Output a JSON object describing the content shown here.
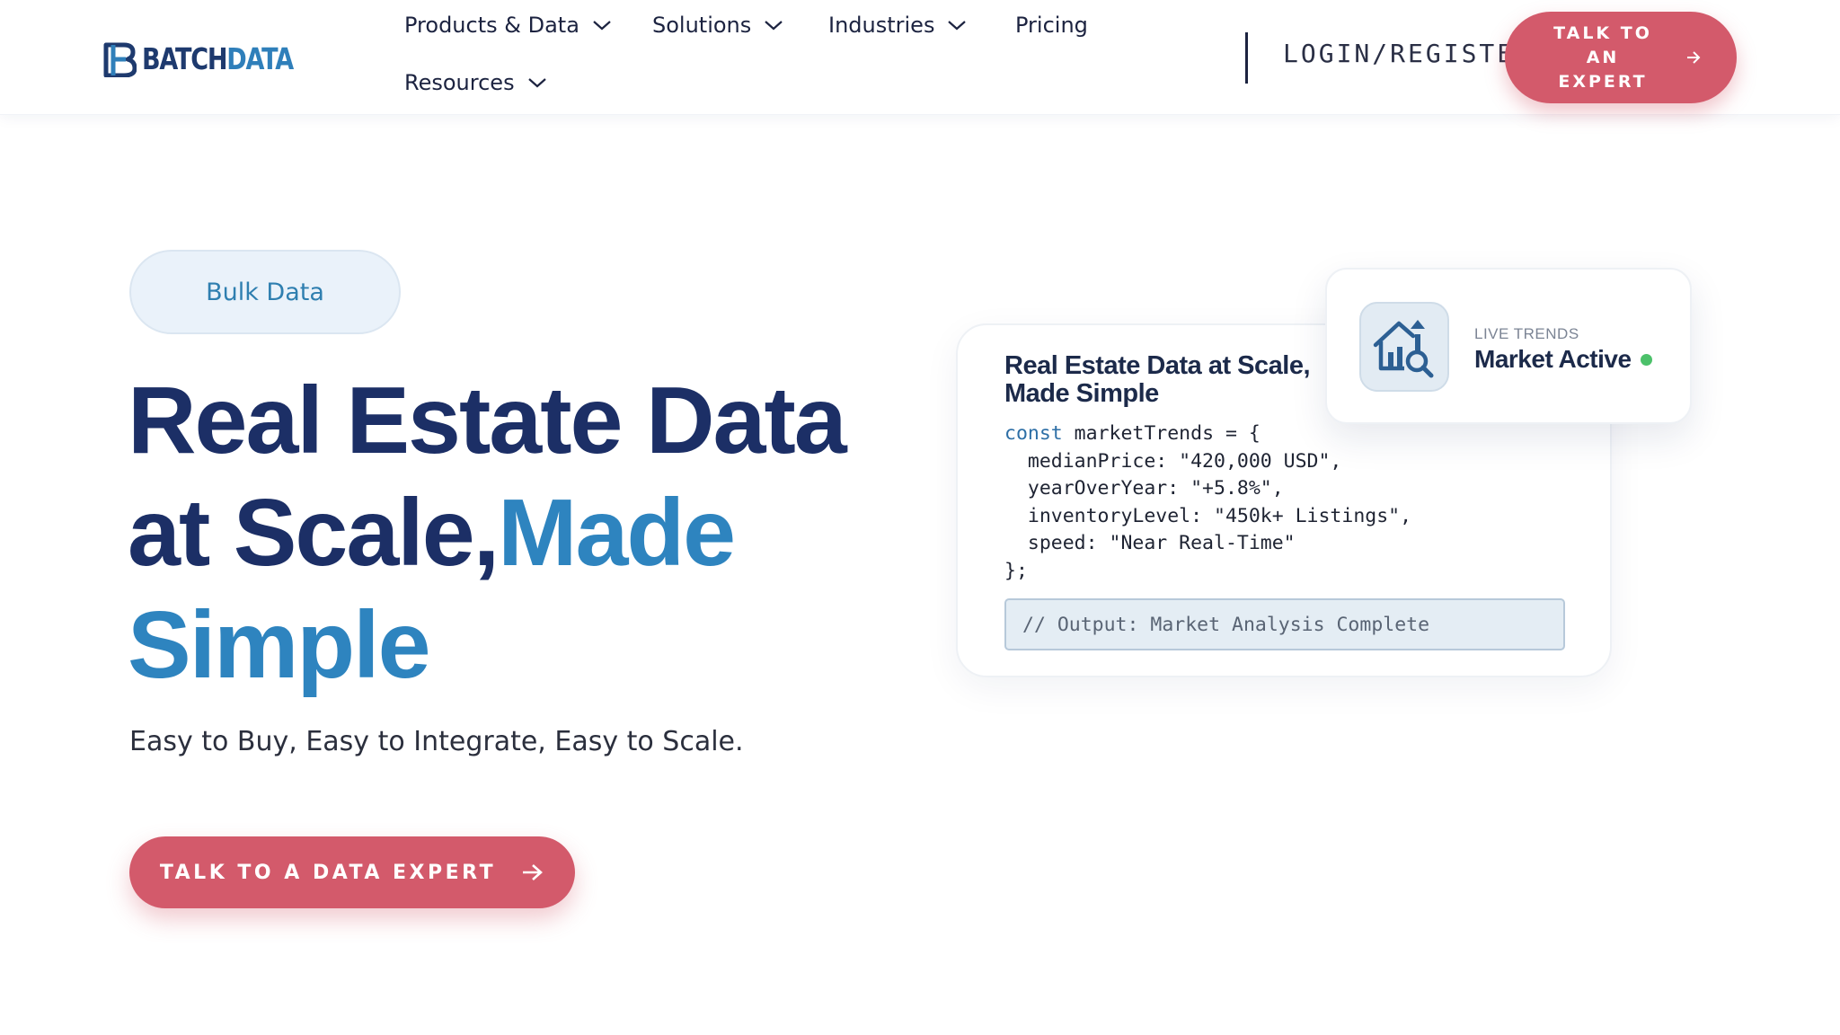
{
  "brand": {
    "logo_part1": "BATCH",
    "logo_part2": "DATA",
    "primary_color": "#1c2f66",
    "accent_color": "#2e84bf",
    "cta_color": "#d35a6b"
  },
  "nav": {
    "items": [
      {
        "label": "Products & Data",
        "has_dropdown": true
      },
      {
        "label": "Solutions",
        "has_dropdown": true
      },
      {
        "label": "Industries",
        "has_dropdown": true
      },
      {
        "label": "Pricing",
        "has_dropdown": false
      },
      {
        "label": "Resources",
        "has_dropdown": true
      }
    ],
    "login_label": "LOGIN/REGISTER",
    "talk_expert_label": "TALK TO AN EXPERT"
  },
  "hero": {
    "badge": "Bulk Data",
    "title_line1": "Real Estate Data",
    "title_line2_a": "at Scale,",
    "title_line2_b": "Made",
    "title_line3": "Simple",
    "subtitle": "Easy to Buy, Easy to Integrate, Easy to Scale.",
    "cta_label": "TALK TO A DATA EXPERT"
  },
  "code_card": {
    "title": "Real Estate Data at Scale, Made Simple",
    "keyword": "const",
    "lines": [
      " marketTrends = {",
      "  medianPrice: \"420,000 USD\",",
      "  yearOverYear: \"+5.8%\",",
      "  inventoryLevel: \"450k+ Listings\",",
      "  speed: \"Near Real-Time\"",
      "};"
    ],
    "output": "// Output: Market Analysis Complete"
  },
  "trend_card": {
    "label": "LIVE TRENDS",
    "status": "Market Active",
    "status_color": "#4cc16a",
    "icon": "house-chart-search-icon"
  }
}
